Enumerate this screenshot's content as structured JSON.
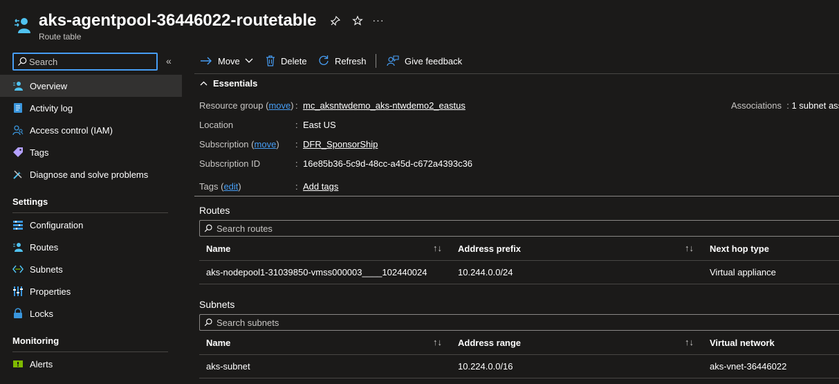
{
  "header": {
    "title": "aks-agentpool-36446022-routetable",
    "subtitle": "Route table",
    "pin_icon": "pin-icon",
    "favorite_icon": "star-icon",
    "more_label": "···"
  },
  "sidebar": {
    "search_placeholder": "Search",
    "collapse_label": "«",
    "items": [
      {
        "label": "Overview",
        "icon": "overview-icon"
      },
      {
        "label": "Activity log",
        "icon": "activity-log-icon"
      },
      {
        "label": "Access control (IAM)",
        "icon": "iam-icon"
      },
      {
        "label": "Tags",
        "icon": "tag-icon"
      },
      {
        "label": "Diagnose and solve problems",
        "icon": "wrench-icon"
      }
    ],
    "settings_title": "Settings",
    "settings_items": [
      {
        "label": "Configuration",
        "icon": "configuration-icon"
      },
      {
        "label": "Routes",
        "icon": "routes-icon"
      },
      {
        "label": "Subnets",
        "icon": "subnets-icon"
      },
      {
        "label": "Properties",
        "icon": "properties-icon"
      },
      {
        "label": "Locks",
        "icon": "lock-icon"
      }
    ],
    "monitoring_title": "Monitoring",
    "monitoring_items": [
      {
        "label": "Alerts",
        "icon": "alerts-icon"
      }
    ]
  },
  "toolbar": {
    "move": "Move",
    "delete": "Delete",
    "refresh": "Refresh",
    "feedback": "Give feedback"
  },
  "essentials": {
    "title": "Essentials",
    "resource_group_label": "Resource group",
    "move_link": "move",
    "resource_group_value": "mc_aksntwdemo_aks-ntwdemo2_eastus",
    "location_label": "Location",
    "location_value": "East US",
    "subscription_label": "Subscription",
    "subscription_value": "DFR_SponsorShip",
    "subscription_id_label": "Subscription ID",
    "subscription_id_value": "16e85b36-5c9d-48cc-a45d-c672a4393c36",
    "tags_label": "Tags",
    "edit_link": "edit",
    "tags_value": "Add tags",
    "associations_label": "Associations",
    "associations_value": "1 subnet ass",
    "open_paren": "(",
    "close_paren": ")",
    "colon": ":"
  },
  "routes": {
    "title": "Routes",
    "search_placeholder": "Search routes",
    "columns": [
      "Name",
      "Address prefix",
      "Next hop type"
    ],
    "sort_glyph": "↑↓",
    "rows": [
      [
        "aks-nodepool1-31039850-vmss000003____102440024",
        "10.244.0.0/24",
        "Virtual appliance"
      ]
    ]
  },
  "subnets": {
    "title": "Subnets",
    "search_placeholder": "Search subnets",
    "columns": [
      "Name",
      "Address range",
      "Virtual network"
    ],
    "sort_glyph": "↑↓",
    "rows": [
      [
        "aks-subnet",
        "10.224.0.0/16",
        "aks-vnet-36446022"
      ]
    ]
  },
  "colors": {
    "background": "#1b1a19",
    "accent": "#479ef5",
    "active_nav": "#323130"
  }
}
